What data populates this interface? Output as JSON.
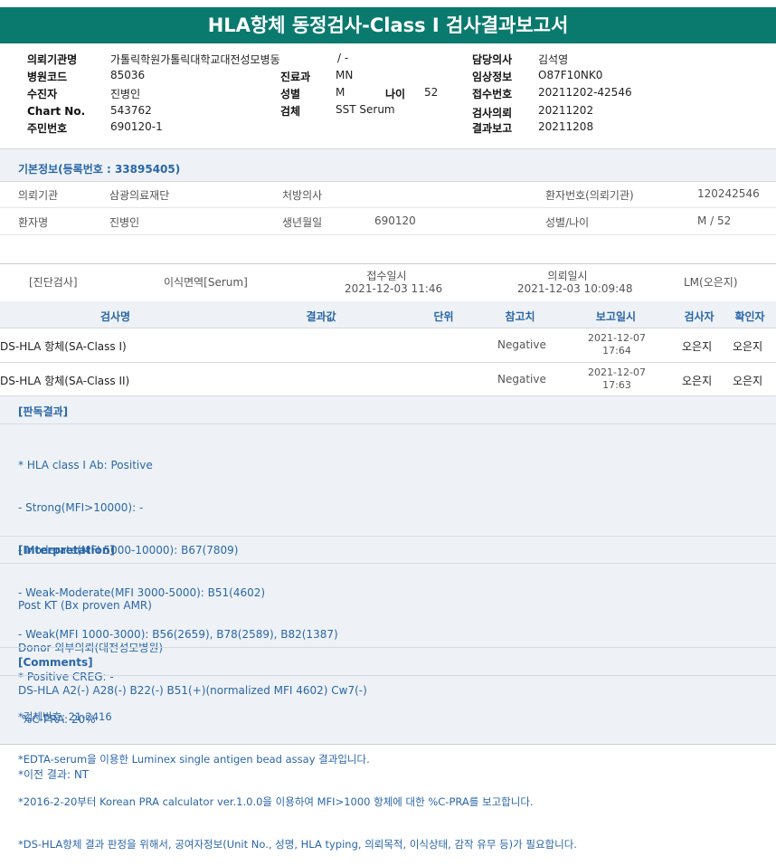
{
  "title": "HLA항체 동정검사-Class I 검사결과보고서",
  "header": {
    "request_org": {
      "label": "의뢰기관명",
      "value": "가톨릭학원가톨릭대학교대전성모병동",
      "extra": "/ -"
    },
    "hospital_code": {
      "label": "병원코드",
      "value": "85036"
    },
    "dept": {
      "label": "진료과",
      "value": "MN"
    },
    "examinee": {
      "label": "수진자",
      "value": "진병인"
    },
    "sex": {
      "label": "성별",
      "value": "M"
    },
    "age": {
      "label": "나이",
      "value": "52"
    },
    "chart_no": {
      "label": "Chart No.",
      "value": "543762"
    },
    "specimen": {
      "label": "검체",
      "value": "SST Serum"
    },
    "resident_no": {
      "label": "주민번호",
      "value": "690120-1"
    },
    "doctor": {
      "label": "담당의사",
      "value": "김석영"
    },
    "clinical": {
      "label": "임상정보",
      "value": "O87F10NK0"
    },
    "receipt_no": {
      "label": "접수번호",
      "value": "20211202-42546"
    },
    "test_request": {
      "label": "검사의뢰",
      "value": "20211202"
    },
    "result_report": {
      "label": "결과보고",
      "value": "20211208"
    }
  },
  "basic_info": {
    "title": "기본정보(등록번호 : 33895405)",
    "org_label": "의뢰기관",
    "org_value": "삼광의료재단",
    "doctor_label": "처방의사",
    "doctor_value": "",
    "patient_no_label": "환자번호(의뢰기관)",
    "patient_no_value": "120242546",
    "patient_label": "환자명",
    "patient_value": "진병인",
    "birth_label": "생년월일",
    "birth_value": "690120",
    "sexage_label": "성별/나이",
    "sexage_value": "M / 52"
  },
  "diag": {
    "label": "[진단검사]",
    "test": "이식면역[Serum]",
    "received_label": "접수일시",
    "received_value": "2021-12-03  11:46",
    "requested_label": "의뢰일시",
    "requested_value": "2021-12-03  10:09:48",
    "lab": "LM(오은지)"
  },
  "table": {
    "headers": [
      "검사명",
      "결과값",
      "단위",
      "참고치",
      "보고일시",
      "검사자",
      "확인자"
    ],
    "rows": [
      {
        "name": "DS-HLA 항체(SA-Class I)",
        "result": "",
        "unit": "",
        "ref": "Negative",
        "date": "2021-12-07",
        "time": "17:64",
        "tester": "오은지",
        "confirmer": "오은지"
      },
      {
        "name": "DS-HLA 항체(SA-Class II)",
        "result": "",
        "unit": "",
        "ref": "Negative",
        "date": "2021-12-07",
        "time": "17:63",
        "tester": "오은지",
        "confirmer": "오은지"
      }
    ]
  },
  "interpretation": {
    "title1": "[판독결과]",
    "lines1": [
      "* HLA class I Ab: Positive",
      "- Strong(MFI>10000): -",
      "- Moderate(MFI 5000-10000): B67(7809)",
      "- Weak-Moderate(MFI 3000-5000): B51(4602)",
      "- Weak(MFI 1000-3000): B56(2659), B78(2589), B82(1387)",
      "* Positive CREG: -",
      " %C-PRA: 20%"
    ],
    "title2": "[Interpretation]",
    "lines2": [
      "Post KT (Bx proven AMR)",
      "Donor 외부의뢰(대전성모병원)",
      "DS-HLA A2(-) A28(-) B22(-) B51(+)(normalized MFI 4602) Cw7(-)",
      "",
      "*이전 결과: NT"
    ],
    "title3": "[Comments]",
    "lines3": [
      "*검체번호: 21-2416",
      "*EDTA-serum을 이용한 Luminex single antigen bead assay 결과입니다.",
      "*2016-2-20부터 Korean PRA calculator ver.1.0.0을 이용하여 MFI>1000 항체에 대한 %C-PRA를 보고합니다.",
      "*DS-HLA항체 결과 판정을 위해서, 공여자정보(Unit No., 성명, HLA typing, 의뢰목적, 이식상태, 감작 유무 등)가 필요합니다."
    ]
  }
}
